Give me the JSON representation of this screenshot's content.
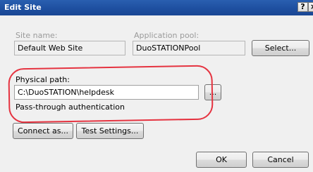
{
  "window": {
    "title": "Edit Site",
    "help_label": "?",
    "close_label": "×"
  },
  "site_name": {
    "label": "Site name:",
    "value": "Default Web Site"
  },
  "app_pool": {
    "label": "Application pool:",
    "value": "DuoSTATIONPool",
    "select_label": "Select..."
  },
  "physical_path": {
    "label": "Physical path:",
    "value": "C:\\DuoSTATION\\helpdesk",
    "browse_label": "..."
  },
  "pass_through": {
    "label": "Pass-through authentication"
  },
  "buttons": {
    "connect_as": "Connect as...",
    "test_settings": "Test Settings...",
    "ok": "OK",
    "cancel": "Cancel"
  },
  "colors": {
    "titlebar": "#1e4fa0",
    "highlight": "#e53340",
    "dialog_bg": "#f0f0f0"
  }
}
